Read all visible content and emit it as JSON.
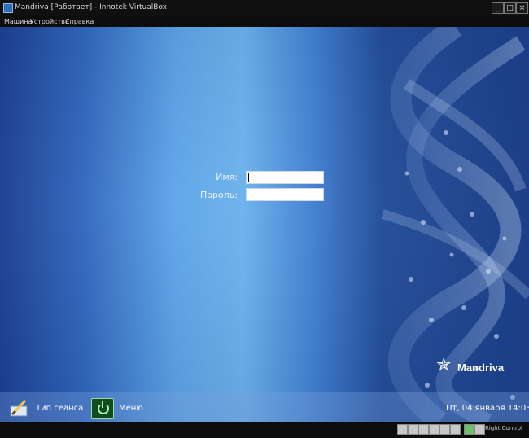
{
  "window": {
    "title": "Mandriva [Работает] - Innotek VirtualBox",
    "controls": {
      "minimize": "_",
      "maximize": "□",
      "close": "×"
    }
  },
  "menubar": {
    "items": [
      "Машина",
      "Устройства",
      "Справка"
    ]
  },
  "login": {
    "username_label": "Имя:",
    "password_label": "Пароль:",
    "username_value": "",
    "password_value": ""
  },
  "branding": {
    "logo_text": "Mandriva",
    "logo_icon": "mandriva-star-icon"
  },
  "panel": {
    "session_label": "Тип сеанса",
    "menu_label": "Меню",
    "clock": "Пт, 04 января 14:03"
  },
  "statusbar": {
    "icons": [
      "hdd-icon",
      "cd-icon",
      "floppy-icon",
      "network-icon",
      "usb-icon",
      "shared-folders-icon",
      "mouse-integration-icon",
      "keyboard-capture-icon"
    ],
    "host_key": "Right Control"
  }
}
